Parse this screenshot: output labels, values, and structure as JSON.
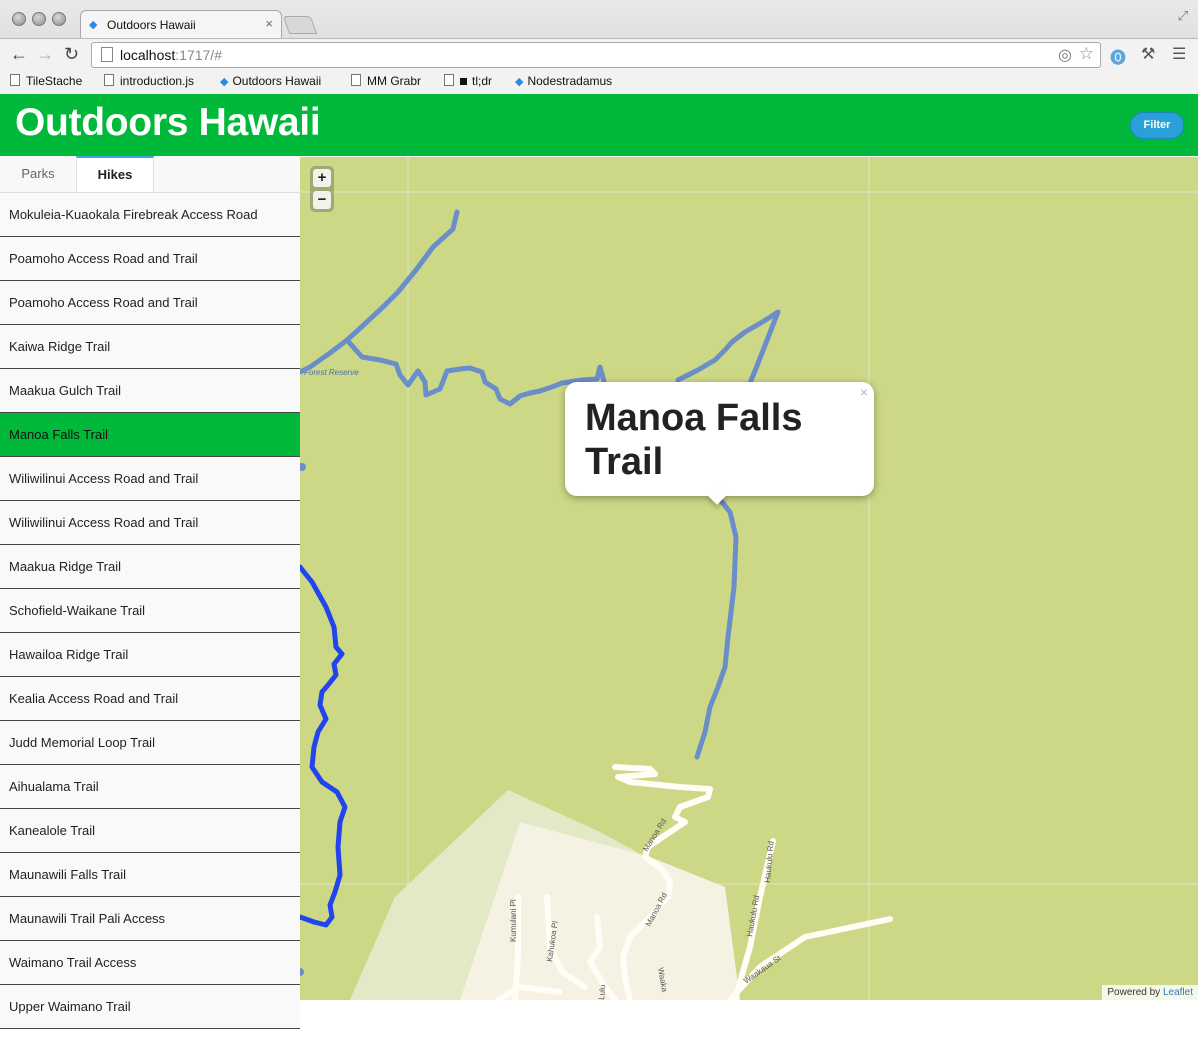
{
  "browser": {
    "tab_title": "Outdoors Hawaii",
    "tab_close": "×",
    "url_host": "localhost",
    "url_rest": ":1717/#",
    "back_icon": "←",
    "forward_icon": "→",
    "reload_icon": "↻",
    "bookmarks": [
      "TileStache",
      "introduction.js",
      "Outdoors Hawaii",
      "MM Grabr",
      "tl;dr",
      "Nodestradamus"
    ]
  },
  "header": {
    "title": "Outdoors Hawaii",
    "filter_label": "Filter"
  },
  "sidebar": {
    "tabs": [
      {
        "label": "Parks",
        "active": false
      },
      {
        "label": "Hikes",
        "active": true
      }
    ],
    "hikes": [
      "Mokuleia-Kuaokala Firebreak Access Road",
      "Poamoho Access Road and Trail",
      "Poamoho Access Road and Trail",
      "Kaiwa Ridge Trail",
      "Maakua Gulch Trail",
      "Manoa Falls Trail",
      "Wiliwilinui Access Road and Trail",
      "Wiliwilinui Access Road and Trail",
      "Maakua Ridge Trail",
      "Schofield-Waikane Trail",
      "Hawailoa Ridge Trail",
      "Kealia Access Road and Trail",
      "Judd Memorial Loop Trail",
      "Aihualama Trail",
      "Kanealole Trail",
      "Maunawili Falls Trail",
      "Maunawili Trail Pali Access",
      "Waimano Trail Access",
      "Upper Waimano Trail"
    ],
    "selected_index": 5
  },
  "map": {
    "zoom_in": "+",
    "zoom_out": "−",
    "popup_title": "Manoa Falls Trail",
    "popup_close": "×",
    "attribution_prefix": "Powered by",
    "attribution_link": "Leaflet",
    "labels": {
      "forest_reserve": "Forest Reserve",
      "manoa_rd_1": "Manoa Rd",
      "manoa_rd_2": "Manoa Rd",
      "kumulani_pl": "Kumulani Pl",
      "kahukoa_pl": "Kahukoa Pl",
      "haukulu_rd": "Haukulu Rd",
      "waakaua_st": "Waakaua St",
      "lulu": "Lulu",
      "waaka": "Waaka"
    },
    "colors": {
      "land": "#cdd886",
      "urban": "#f5f2e4",
      "trail": "#6a8ec9",
      "highlight_trail": "#2244ee",
      "road": "#fffdf5"
    }
  }
}
